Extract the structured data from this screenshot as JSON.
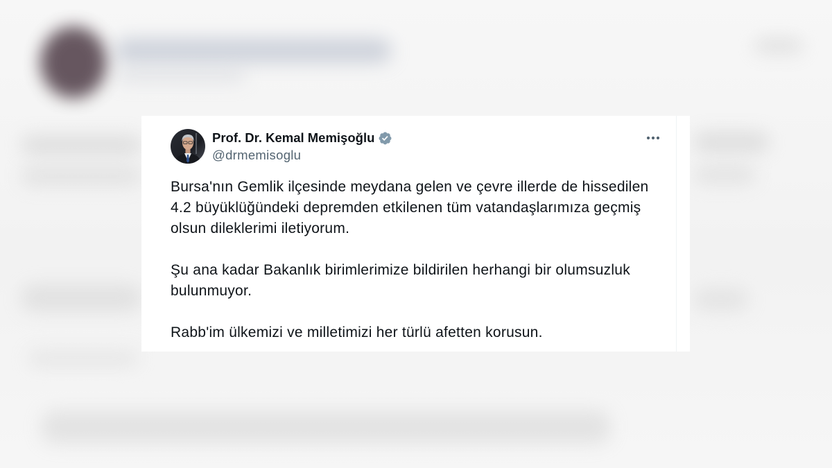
{
  "tweet": {
    "author": {
      "name": "Prof. Dr. Kemal Memişoğlu",
      "handle": "@drmemisoglu",
      "verified_badge_icon": "verified-badge-icon"
    },
    "more_options_icon": "more-options-icon",
    "paragraphs": [
      "Bursa'nın Gemlik ilçesinde meydana gelen ve çevre illerde de hissedilen 4.2 büyüklüğündeki depremden etkilenen tüm vatandaşlarımıza geçmiş olsun dileklerimi iletiyorum.",
      "Şu ana kadar Bakanlık birimlerimize bildirilen herhangi bir olumsuzluk bulunmuyor.",
      "Rabb'im ülkemizi ve milletimizi her türlü afetten korusun."
    ]
  },
  "colors": {
    "primary_text": "#0f1419",
    "secondary_text": "#536471",
    "verified_badge": "#829aab",
    "card_background": "#ffffff",
    "page_background": "#f6f6f6"
  }
}
